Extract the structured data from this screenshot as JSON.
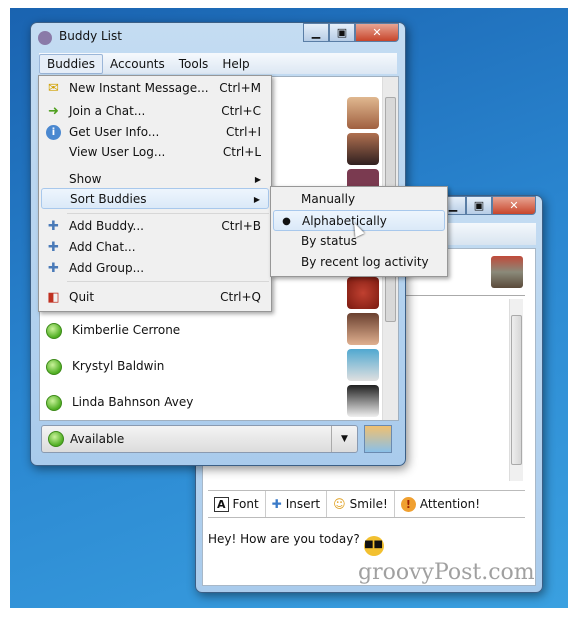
{
  "buddy_window": {
    "title": "Buddy List",
    "menubar": [
      "Buddies",
      "Accounts",
      "Tools",
      "Help"
    ],
    "buddies": [
      {
        "name": "Kimberlie Cerrone"
      },
      {
        "name": "Krystyl Baldwin"
      },
      {
        "name": "Linda Bahnson Avey"
      }
    ],
    "status": "Available"
  },
  "buddies_menu": {
    "items": [
      {
        "label": "New Instant Message...",
        "shortcut": "Ctrl+M",
        "icon": "new-message-icon"
      },
      {
        "label": "Join a Chat...",
        "shortcut": "Ctrl+C",
        "icon": "join-chat-icon"
      },
      {
        "label": "Get User Info...",
        "shortcut": "Ctrl+I",
        "icon": "info-icon"
      },
      {
        "label": "View User Log...",
        "shortcut": "Ctrl+L"
      },
      {
        "label": "Show",
        "submenu": true
      },
      {
        "label": "Sort Buddies",
        "submenu": true
      },
      {
        "label": "Add Buddy...",
        "shortcut": "Ctrl+B",
        "icon": "plus-icon"
      },
      {
        "label": "Add Chat...",
        "icon": "plus-icon"
      },
      {
        "label": "Add Group...",
        "icon": "plus-icon"
      },
      {
        "label": "Quit",
        "shortcut": "Ctrl+Q",
        "icon": "quit-icon"
      }
    ]
  },
  "sort_submenu": {
    "items": [
      "Manually",
      "Alphabetically",
      "By status",
      "By recent log activity"
    ],
    "selected": "Alphabetically"
  },
  "chat_window": {
    "toolbar": [
      "Font",
      "Insert",
      "Smile!",
      "Attention!"
    ],
    "message": "Hey! How are you today?"
  },
  "watermark": "groovyPost.com"
}
